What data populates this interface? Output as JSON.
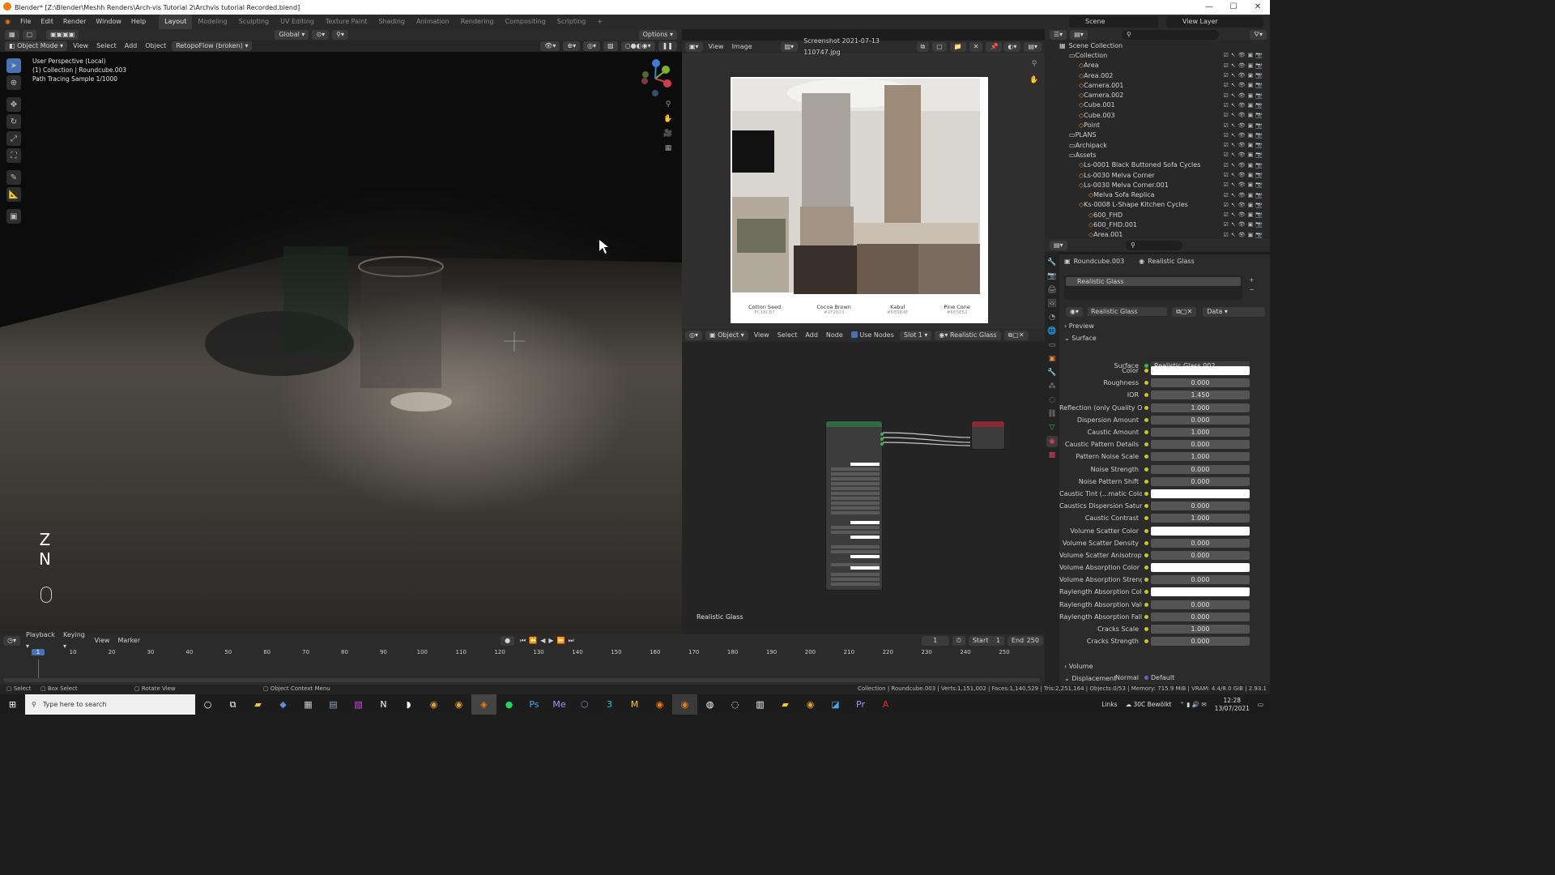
{
  "window": {
    "title": "Blender* [Z:\\Blender\\Meshh Renders\\Arch-vis Tutorial 2\\Archvis tutorial Recorded.blend]",
    "controls": [
      "—",
      "☐",
      "✕"
    ]
  },
  "menu": {
    "items": [
      "File",
      "Edit",
      "Render",
      "Window",
      "Help"
    ],
    "workspaces": [
      "Layout",
      "Modeling",
      "Sculpting",
      "UV Editing",
      "Texture Paint",
      "Shading",
      "Animation",
      "Rendering",
      "Compositing",
      "Scripting"
    ],
    "add_tab": "+",
    "scene_label": "Scene",
    "view_layer_label": "View Layer"
  },
  "viewport": {
    "header": {
      "mode": "Object Mode",
      "view": "View",
      "select": "Select",
      "add": "Add",
      "object": "Object",
      "addon": "RetopoFlow (broken)",
      "orientation": "Global",
      "options": "Options"
    },
    "overlay": {
      "line1": "User Perspective (Local)",
      "line2": "(1) Collection | Roundcube.003",
      "line3": "Path Tracing Sample 1/1000"
    },
    "hud": {
      "z": "Z",
      "n": "N"
    }
  },
  "image_editor": {
    "view": "View",
    "image": "Image",
    "filename": "Screenshot 2021-07-13 110747.jpg",
    "swatches": [
      {
        "name": "Cotton Seed",
        "code": "PC18CB7",
        "color": "#c8c5bd"
      },
      {
        "name": "Cocoa Brown",
        "code": "#2F2823",
        "color": "#3a302a"
      },
      {
        "name": "Kabul",
        "code": "#6B5B4E",
        "color": "#6b5b4e"
      },
      {
        "name": "Pine Cone",
        "code": "#6E5E52",
        "color": "#7a6a5f"
      }
    ]
  },
  "node_editor": {
    "object": "Object",
    "view": "View",
    "select": "Select",
    "add": "Add",
    "node": "Node",
    "use_nodes": "Use Nodes",
    "slot": "Slot 1",
    "material": "Realistic Glass",
    "footer": "Realistic Glass"
  },
  "outliner": {
    "title": "Scene Collection",
    "rows": [
      {
        "name": "Collection",
        "indent": 1
      },
      {
        "name": "Area",
        "indent": 2
      },
      {
        "name": "Area.002",
        "indent": 2
      },
      {
        "name": "Camera.001",
        "indent": 2
      },
      {
        "name": "Camera.002",
        "indent": 2
      },
      {
        "name": "Cube.001",
        "indent": 2
      },
      {
        "name": "Cube.003",
        "indent": 2
      },
      {
        "name": "Point",
        "indent": 2
      },
      {
        "name": "PLANS",
        "indent": 1
      },
      {
        "name": "Archipack",
        "indent": 1
      },
      {
        "name": "Assets",
        "indent": 1
      },
      {
        "name": "Ls-0001 Black Buttoned Sofa Cycles",
        "indent": 2
      },
      {
        "name": "Ls-0030 Melva Corner",
        "indent": 2
      },
      {
        "name": "Ls-0030 Melva Corner.001",
        "indent": 2
      },
      {
        "name": "Melva Sofa Replica",
        "indent": 3
      },
      {
        "name": "Ks-0008 L-Shape Kitchen Cycles",
        "indent": 2
      },
      {
        "name": "600_FHD",
        "indent": 3
      },
      {
        "name": "600_FHD.001",
        "indent": 3
      },
      {
        "name": "Area.001",
        "indent": 3
      }
    ]
  },
  "properties": {
    "object": "Roundcube.003",
    "material": "Realistic Glass",
    "slot_item": "Realistic Glass",
    "mat_field": "Realistic Glass",
    "data_label": "Data",
    "preview": "Preview",
    "surface": "Surface",
    "surface_label": "Surface",
    "surface_value": "Realistic Glass.002",
    "rows": [
      {
        "label": "Color",
        "value": "",
        "white": true
      },
      {
        "label": "Roughness",
        "value": "0.000"
      },
      {
        "label": "IOR",
        "value": "1.450"
      },
      {
        "label": "Reflection (only Quality O...",
        "value": "1.000"
      },
      {
        "label": "Dispersion Amount",
        "value": "0.000"
      },
      {
        "label": "Caustic Amount",
        "value": "1.000"
      },
      {
        "label": "Caustic Pattern Details",
        "value": "0.000"
      },
      {
        "label": "Pattern Noise Scale",
        "value": "1.000"
      },
      {
        "label": "Noise Strength",
        "value": "0.000"
      },
      {
        "label": "Noise Pattern Shift",
        "value": "0.000"
      },
      {
        "label": "Caustic Tint (...matic Color)",
        "value": "",
        "white": true
      },
      {
        "label": "Caustics Dispersion Satur...",
        "value": "0.000"
      },
      {
        "label": "Caustic Contrast",
        "value": "1.000"
      },
      {
        "label": "Volume Scatter Color",
        "value": "",
        "white": true
      },
      {
        "label": "Volume Scatter Density",
        "value": "0.000"
      },
      {
        "label": "Volume Scatter Anisotropy",
        "value": "0.000"
      },
      {
        "label": "Volume Absorption Color",
        "value": "",
        "white": true
      },
      {
        "label": "Volume Absorption Streng...",
        "value": "0.000"
      },
      {
        "label": "Raylength Absorption Color",
        "value": "",
        "white": true
      },
      {
        "label": "Raylength Absorption Value",
        "value": "0.000"
      },
      {
        "label": "Raylength Absorption Fall...",
        "value": "0.000"
      },
      {
        "label": "Cracks Scale",
        "value": "1.000"
      },
      {
        "label": "Cracks Strength",
        "value": "0.000"
      }
    ],
    "normal_label": "Normal",
    "normal_value": "Default",
    "volume": "Volume",
    "displacement": "Displacement"
  },
  "timeline": {
    "playback": "Playback",
    "keying": "Keying",
    "view": "View",
    "marker": "Marker",
    "current_frame": "1",
    "start_label": "Start",
    "start": "1",
    "end_label": "End",
    "end": "250",
    "ticks": [
      "1",
      "10",
      "20",
      "30",
      "40",
      "50",
      "60",
      "70",
      "80",
      "90",
      "100",
      "110",
      "120",
      "130",
      "140",
      "150",
      "160",
      "170",
      "180",
      "190",
      "200",
      "210",
      "220",
      "230",
      "240",
      "250"
    ]
  },
  "status": {
    "select": "Select",
    "box_select": "Box Select",
    "rotate": "Rotate View",
    "context": "Object Context Menu",
    "info": "Collection | Roundcube.003 | Verts:1,151,002 | Faces:1,140,529 | Tris:2,251,164 | Objects:0/53 | Memory: 715.9 MiB | VRAM: 4.4/8.0 GiB | 2.93.1"
  },
  "taskbar": {
    "search_placeholder": "Type here to search",
    "links": "Links",
    "weather": "30C  Bewölkt",
    "time": "12:28",
    "date": "13/07/2021"
  },
  "colors": {
    "accent": "#4772b3",
    "selected_frame": "#4772b3"
  }
}
